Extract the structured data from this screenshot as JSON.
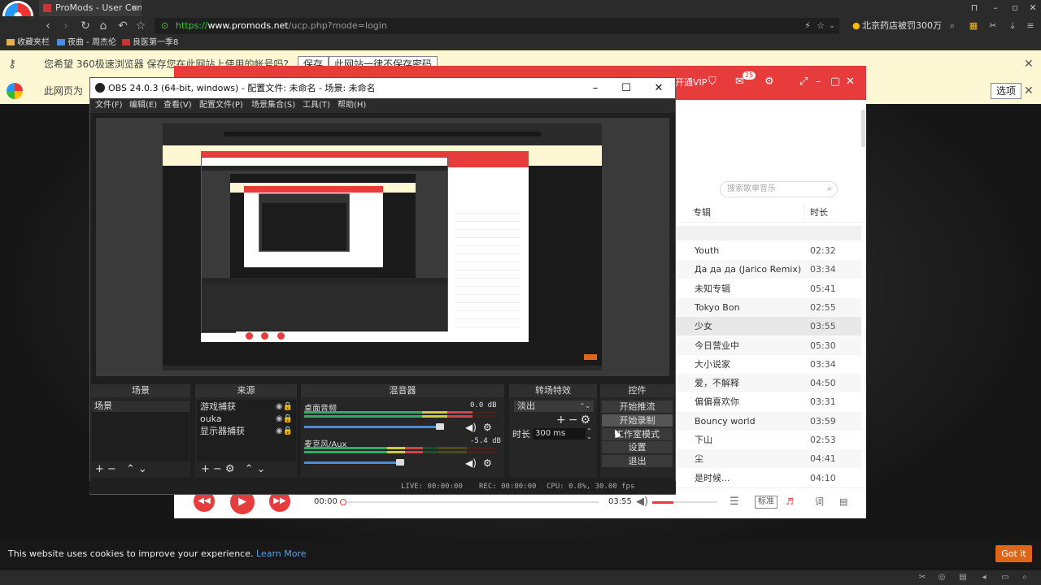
{
  "browser": {
    "tab_title": "ProMods - User Cont",
    "url_https": "https://",
    "url_host": "www.promods.net",
    "url_path": "/ucp.php?mode=login",
    "search_text": "北京药店被罚300万",
    "bookmarks": [
      "收藏夹栏",
      "夜曲 - 周杰伦",
      "良医第一季8"
    ],
    "password_prompt": "您希望 360极速浏览器 保存您在此网站上使用的帐号吗?",
    "save_button": "保存",
    "never_button": "此网站一律不保存密码",
    "translate_prompt": "此网页为",
    "options_button": "选项"
  },
  "page": {
    "cookie_text": "This website uses cookies to improve your experience.",
    "learn_more": "Learn More",
    "got_it": "Got it"
  },
  "music": {
    "vip_label": "开通VIP",
    "mail_count": "25",
    "search_placeholder": "搜索歌单音乐",
    "col_album": "专辑",
    "col_duration": "时长",
    "rows": [
      {
        "album": "Youth",
        "duration": "02:32"
      },
      {
        "album": "Да да да (Jarico Remix)",
        "duration": "03:34"
      },
      {
        "album": "未知专辑",
        "duration": "05:41"
      },
      {
        "album": "Tokyo Bon",
        "duration": "02:55"
      },
      {
        "album": "少女",
        "duration": "03:55"
      },
      {
        "album": "今日营业中",
        "duration": "05:30"
      },
      {
        "album": "大小说家",
        "duration": "03:34"
      },
      {
        "album": "爱，不解释",
        "duration": "04:50"
      },
      {
        "album": "偏偏喜欢你",
        "duration": "03:31"
      },
      {
        "album": "Bouncy world",
        "duration": "03:59"
      },
      {
        "album": "下山",
        "duration": "02:53"
      },
      {
        "album": "尘",
        "duration": "04:41"
      },
      {
        "album": "是时候...",
        "duration": "04:10"
      }
    ],
    "time_current": "00:00",
    "time_total": "03:55",
    "progress": 0,
    "volume": 0.33,
    "quality_label": "标准",
    "lyrics_label": "词"
  },
  "obs": {
    "title": "OBS 24.0.3 (64-bit, windows) - 配置文件: 未命名 - 场景: 未命名",
    "menu": [
      "文件(F)",
      "编辑(E)",
      "查看(V)",
      "配置文件(P)",
      "场景集合(S)",
      "工具(T)",
      "帮助(H)"
    ],
    "docks": {
      "scenes": "场景",
      "sources": "来源",
      "mixer": "混音器",
      "transitions": "转场特效",
      "controls": "控件"
    },
    "scene_items": [
      "场景"
    ],
    "source_items": [
      "游戏捕获",
      "ouka",
      "显示器捕获"
    ],
    "mixer_channels": [
      {
        "name": "桌面音频",
        "db": "0.0 dB",
        "level": 0.88
      },
      {
        "name": "麦克风/Aux",
        "db": "-5.4 dB",
        "level": 0.62
      }
    ],
    "transition_select": "淡出",
    "duration_label": "时长",
    "duration_value": "300 ms",
    "controls": [
      "开始推流",
      "开始录制",
      "工作室模式",
      "设置",
      "退出"
    ],
    "status": {
      "live": "LIVE: 00:00:00",
      "rec": "REC: 00:00:00",
      "cpu": "CPU: 0.8%, 30.00 fps"
    }
  }
}
